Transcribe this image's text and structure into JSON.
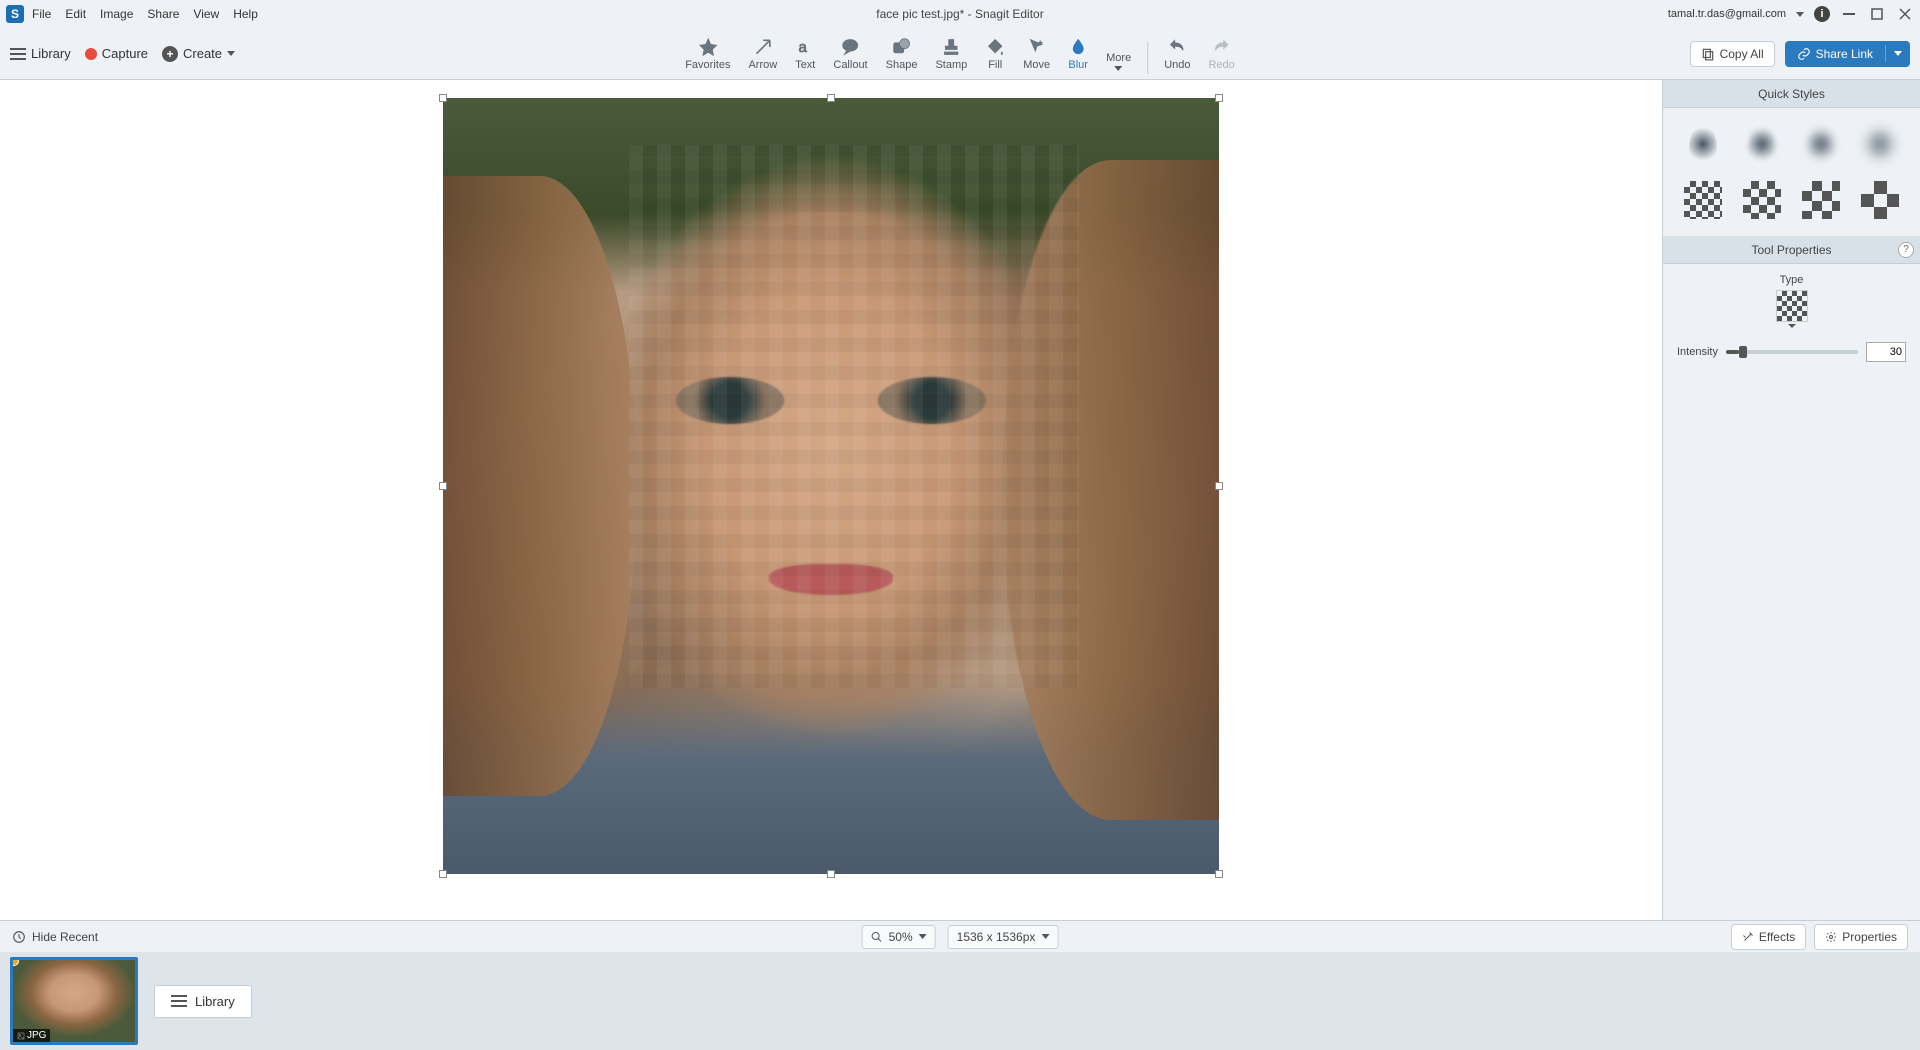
{
  "titlebar": {
    "menus": [
      "File",
      "Edit",
      "Image",
      "Share",
      "View",
      "Help"
    ],
    "title": "face pic test.jpg* - Snagit Editor",
    "user_email": "tamal.tr.das@gmail.com"
  },
  "toolbar": {
    "library_label": "Library",
    "capture_label": "Capture",
    "create_label": "Create",
    "tools": [
      {
        "id": "favorites",
        "label": "Favorites"
      },
      {
        "id": "arrow",
        "label": "Arrow"
      },
      {
        "id": "text",
        "label": "Text"
      },
      {
        "id": "callout",
        "label": "Callout"
      },
      {
        "id": "shape",
        "label": "Shape"
      },
      {
        "id": "stamp",
        "label": "Stamp"
      },
      {
        "id": "fill",
        "label": "Fill"
      },
      {
        "id": "move",
        "label": "Move"
      },
      {
        "id": "blur",
        "label": "Blur",
        "active": true
      }
    ],
    "more_label": "More",
    "undo_label": "Undo",
    "redo_label": "Redo",
    "copyall_label": "Copy All",
    "share_label": "Share Link"
  },
  "right_panel": {
    "quick_styles_label": "Quick Styles",
    "tool_properties_label": "Tool Properties",
    "type_label": "Type",
    "intensity_label": "Intensity",
    "intensity_value": "30"
  },
  "statusbar": {
    "hide_recent_label": "Hide Recent",
    "zoom_label": "50%",
    "dimensions_label": "1536 x 1536px",
    "effects_label": "Effects",
    "properties_label": "Properties"
  },
  "recent_tray": {
    "thumb_badge": "JPG",
    "library_label": "Library"
  }
}
